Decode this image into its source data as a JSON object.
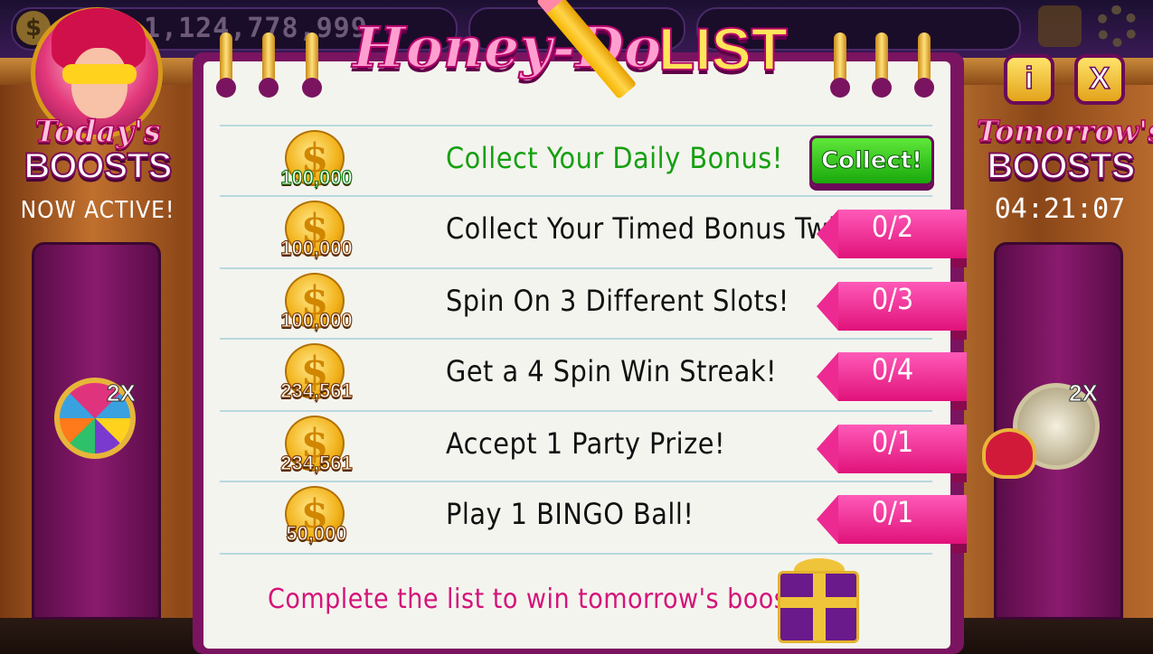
{
  "top_bar": {
    "coin_balance": "1,124,778,999",
    "coin_icon": "dollar-coin-icon"
  },
  "title": {
    "script_part": "Honey-Do",
    "list_part": "LIST"
  },
  "left_panel": {
    "heading_script": "Today's",
    "heading_bold": "BOOSTS",
    "status": "NOW ACTIVE!",
    "multiplier": "2X",
    "boost_icon": "prize-wheel-icon"
  },
  "right_panel": {
    "heading_script": "Tomorrow's",
    "heading_bold": "BOOSTS",
    "countdown": "04:21:07",
    "multiplier": "2X",
    "boost_icon": "star-lock-icon"
  },
  "buttons": {
    "info": "i",
    "close": "X"
  },
  "tasks": [
    {
      "reward": "100,000",
      "text": "Collect Your Daily Bonus!",
      "action": "Collect!",
      "progress": null,
      "completed": true
    },
    {
      "reward": "100,000",
      "text": "Collect Your Timed Bonus Twice!",
      "action": null,
      "progress": "0/2",
      "completed": false
    },
    {
      "reward": "100,000",
      "text": "Spin On 3 Different Slots!",
      "action": null,
      "progress": "0/3",
      "completed": false
    },
    {
      "reward": "234,561",
      "text": "Get a 4 Spin Win Streak!",
      "action": null,
      "progress": "0/4",
      "completed": false
    },
    {
      "reward": "234,561",
      "text": "Accept 1 Party Prize!",
      "action": null,
      "progress": "0/1",
      "completed": false
    },
    {
      "reward": "50,000",
      "text": "Play 1 BINGO Ball!",
      "action": null,
      "progress": "0/1",
      "completed": false
    }
  ],
  "footer": {
    "text": "Complete the list to win tomorrow's boosts +",
    "gift_icon": "gift-box-icon"
  },
  "colors": {
    "accent_pink": "#e0127a",
    "collect_green": "#19a80c",
    "frame_purple": "#7a1460",
    "paper": "#f4f4ee"
  }
}
